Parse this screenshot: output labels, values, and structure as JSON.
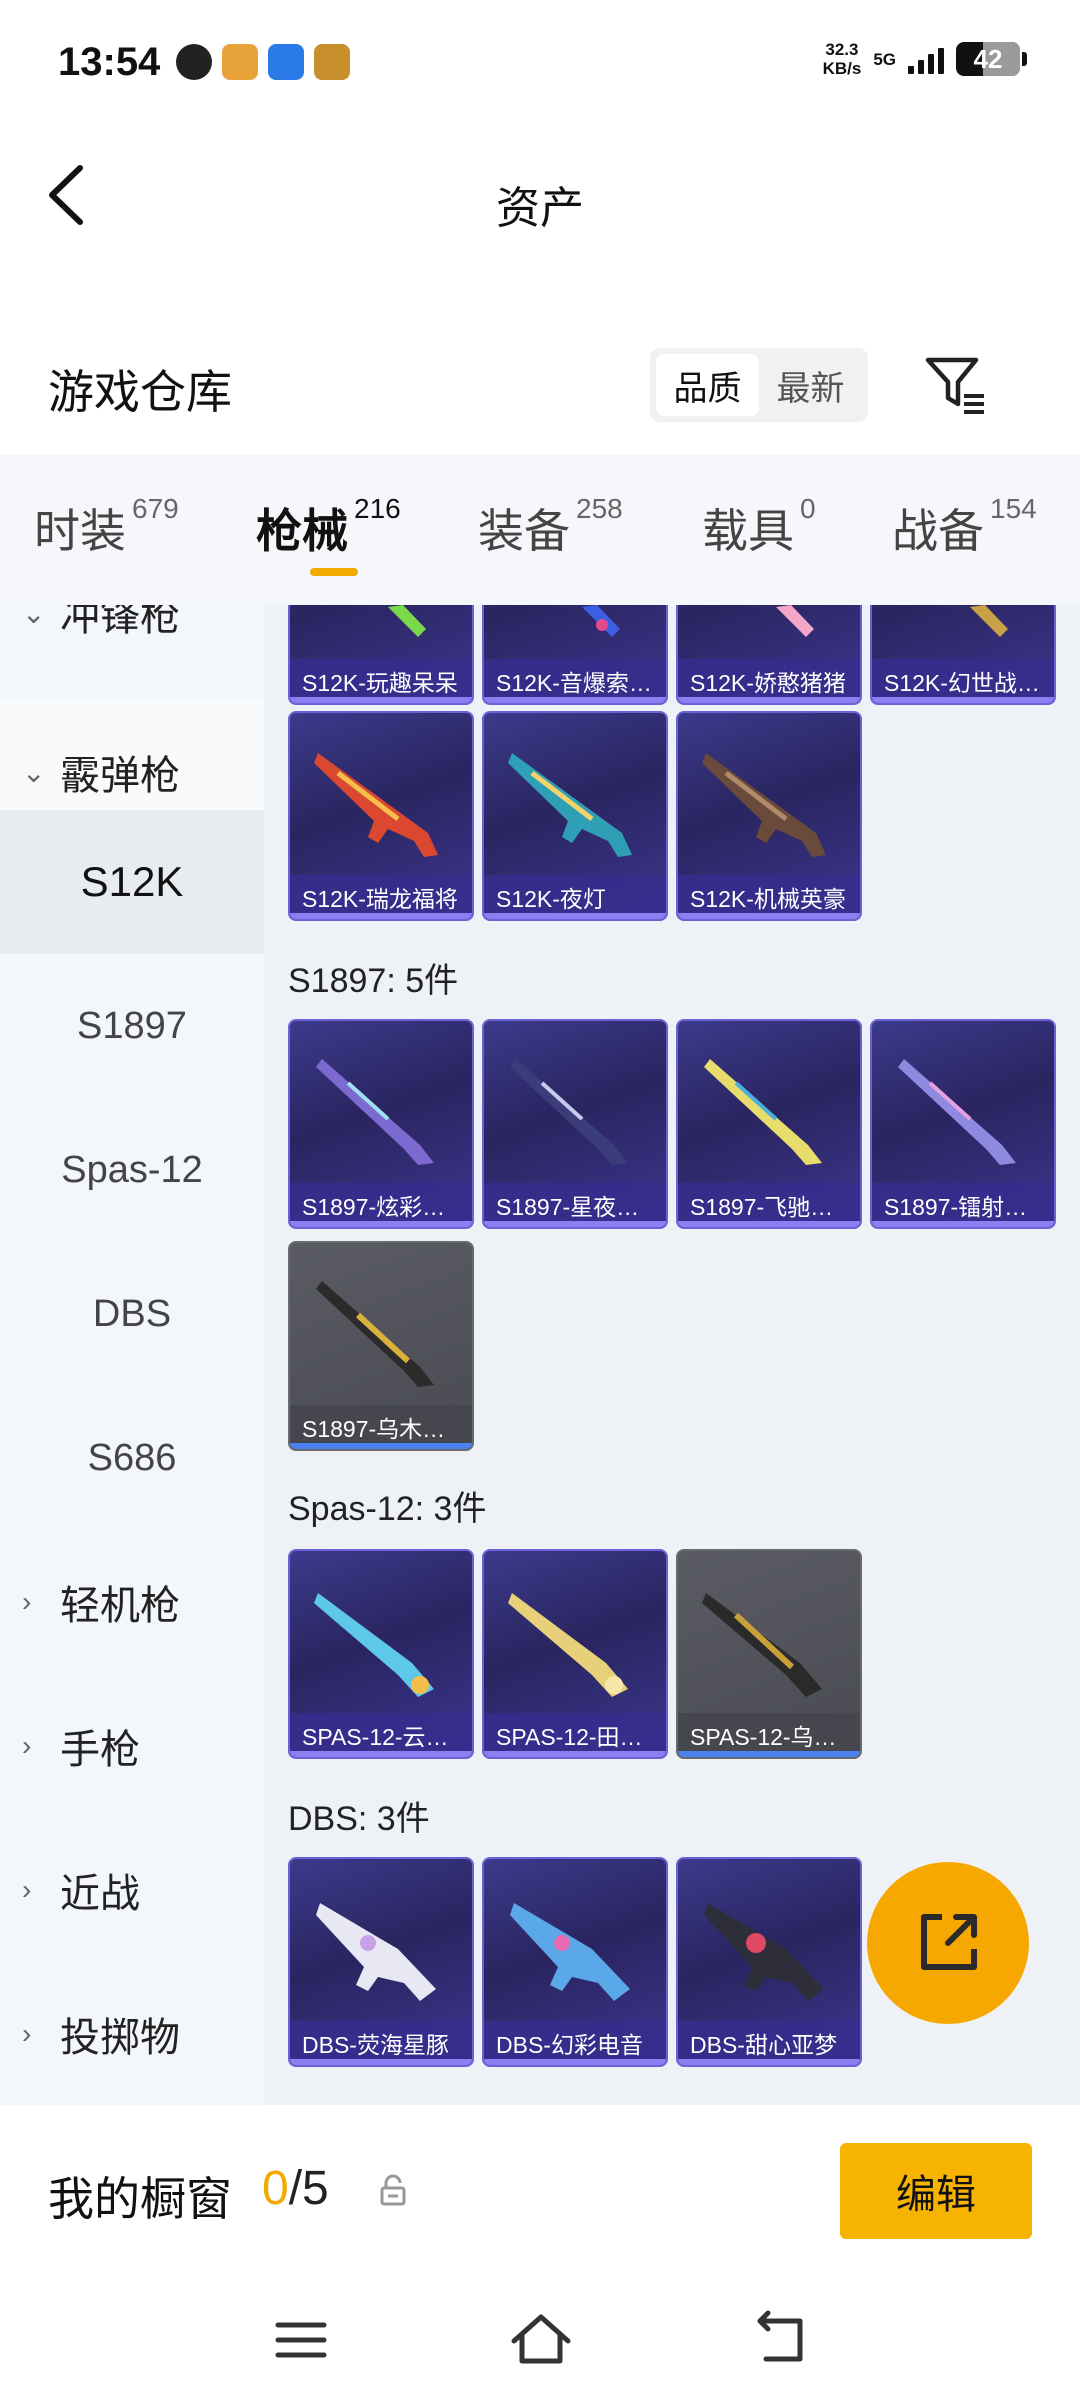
{
  "status": {
    "time": "13:54",
    "speed_value": "32.3",
    "speed_unit": "KB/s",
    "network": "5G",
    "battery": "42"
  },
  "header": {
    "title": "资产"
  },
  "warehouse": {
    "title": "游戏仓库",
    "sort_quality": "品质",
    "sort_latest": "最新"
  },
  "tabs": [
    {
      "label": "时装",
      "count": "679"
    },
    {
      "label": "枪械",
      "count": "216"
    },
    {
      "label": "装备",
      "count": "258"
    },
    {
      "label": "载具",
      "count": "0"
    },
    {
      "label": "战备",
      "count": "154"
    }
  ],
  "sidebar": {
    "partial_top": "冲锋枪",
    "shotgun": "霰弹枪",
    "subs": [
      "S12K",
      "S1897",
      "Spas-12",
      "DBS",
      "S686"
    ],
    "lmg": "轻机枪",
    "pistol": "手枪",
    "melee": "近战",
    "throwable": "投掷物"
  },
  "groups": {
    "s12k_top": [
      "S12K-玩趣呆呆",
      "S12K-音爆索…",
      "S12K-娇憨猪猪",
      "S12K-幻世战…"
    ],
    "s12k_row2": [
      "S12K-瑞龙福将",
      "S12K-夜灯",
      "S12K-机械英豪"
    ],
    "s1897_label": "S1897: 5件",
    "s1897": [
      "S1897-炫彩…",
      "S1897-星夜…",
      "S1897-飞驰…",
      "S1897-镭射…",
      "S1897-乌木…"
    ],
    "spas_label": "Spas-12: 3件",
    "spas": [
      "SPAS-12-云…",
      "SPAS-12-田…",
      "SPAS-12-乌…"
    ],
    "dbs_label": "DBS: 3件",
    "dbs": [
      "DBS-荧海星豚",
      "DBS-幻彩电音",
      "DBS-甜心亚梦"
    ]
  },
  "showcase": {
    "title": "我的橱窗",
    "current": "0",
    "separator": "/5",
    "edit_label": "编辑"
  },
  "colors": {
    "accent": "#F4A900",
    "card_purple": "#3C3A8C",
    "card_gray": "#55565D"
  }
}
